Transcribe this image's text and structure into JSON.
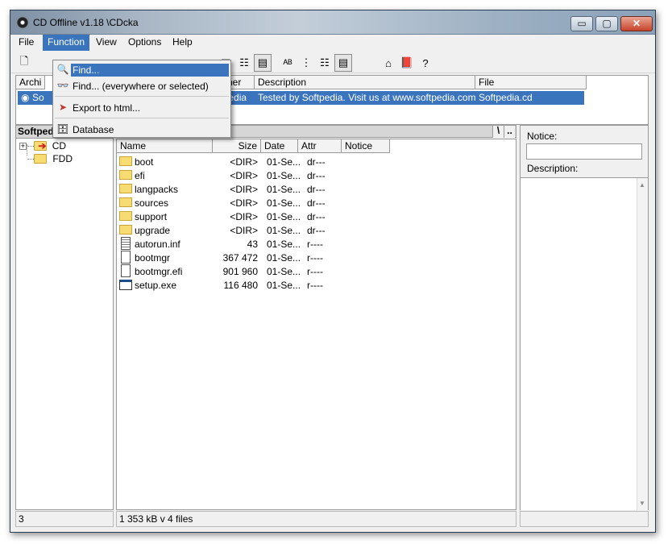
{
  "window": {
    "title": "CD Offline  v1.18   \\CDcka",
    "controls": {
      "minimize": "▭",
      "maximize": "▢",
      "close": "✕"
    }
  },
  "menu": [
    "File",
    "Function",
    "View",
    "Options",
    "Help"
  ],
  "function_menu": {
    "items": [
      "Find...",
      "Find... (everywhere or selected)",
      "Export to html...",
      "Database"
    ]
  },
  "archive_list": {
    "columns": [
      "Archi",
      "ner",
      "Description",
      "File"
    ],
    "selected_row": {
      "name": "So",
      "owner": "ftpedia",
      "description": "Tested by Softpedia. Visit us at www.softpedia.com",
      "file": "Softpedia.cd"
    }
  },
  "tree": {
    "root": "Softpedia",
    "nodes": [
      "CD",
      "FDD"
    ]
  },
  "path": {
    "current": "\\",
    "btn_root": "\\",
    "btn_up": ".."
  },
  "files": {
    "columns": [
      "Name",
      "Size",
      "Date",
      "Attr",
      "Notice"
    ],
    "rows": [
      {
        "icon": "folder-icon",
        "name": "boot",
        "size": "<DIR>",
        "date": "01-Se...",
        "attr": "dr---"
      },
      {
        "icon": "folder-icon",
        "name": "efi",
        "size": "<DIR>",
        "date": "01-Se...",
        "attr": "dr---"
      },
      {
        "icon": "folder-icon",
        "name": "langpacks",
        "size": "<DIR>",
        "date": "01-Se...",
        "attr": "dr---"
      },
      {
        "icon": "folder-icon",
        "name": "sources",
        "size": "<DIR>",
        "date": "01-Se...",
        "attr": "dr---"
      },
      {
        "icon": "folder-icon",
        "name": "support",
        "size": "<DIR>",
        "date": "01-Se...",
        "attr": "dr---"
      },
      {
        "icon": "folder-icon",
        "name": "upgrade",
        "size": "<DIR>",
        "date": "01-Se...",
        "attr": "dr---"
      },
      {
        "icon": "text-file-icon",
        "name": "autorun.inf",
        "size": "43",
        "date": "01-Se...",
        "attr": "r----"
      },
      {
        "icon": "file-icon",
        "name": "bootmgr",
        "size": "367 472",
        "date": "01-Se...",
        "attr": "r----"
      },
      {
        "icon": "file-icon",
        "name": "bootmgr.efi",
        "size": "901 960",
        "date": "01-Se...",
        "attr": "r----"
      },
      {
        "icon": "exe-icon",
        "name": "setup.exe",
        "size": "116 480",
        "date": "01-Se...",
        "attr": "r----"
      }
    ]
  },
  "notice_panel": {
    "notice_label": "Notice:",
    "description_label": "Description:"
  },
  "status": {
    "left": "3",
    "middle": "1 353 kB v 4 files",
    "right": ""
  },
  "colors": {
    "selection": "#3a74bd",
    "folder": "#f7dc73"
  }
}
